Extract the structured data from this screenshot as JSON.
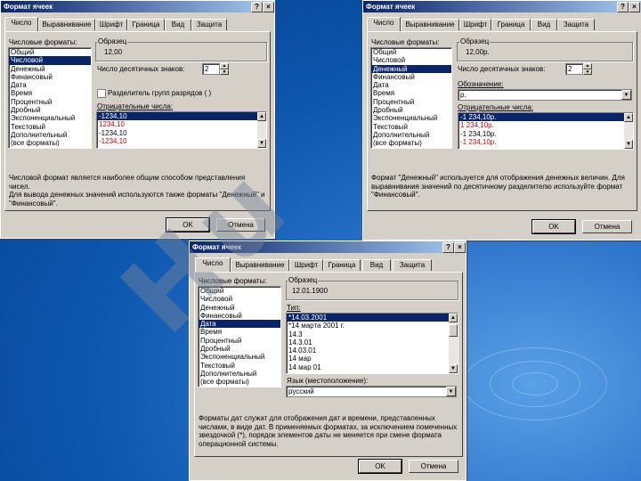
{
  "watermark": "Hu",
  "colors": {
    "title_start": "#0a246a",
    "title_end": "#a6caf0",
    "selection": "#0a246a",
    "negative_red": "#d00000",
    "dialog_face": "#d4d0c8"
  },
  "dialogs": [
    {
      "title": "Формат ячеек",
      "tabs": [
        "Число",
        "Выравнивание",
        "Шрифт",
        "Граница",
        "Вид",
        "Защита"
      ],
      "formats_label": "Числовые форматы:",
      "formats": [
        "Общий",
        "Числовой",
        "Денежный",
        "Финансовый",
        "Дата",
        "Время",
        "Процентный",
        "Дробный",
        "Экспоненциальный",
        "Текстовый",
        "Дополнительный",
        "(все форматы)"
      ],
      "selected_format": "Числовой",
      "sample_label": "Образец",
      "sample_value": "12,00",
      "decimals_label": "Число десятичных знаков:",
      "decimals_value": "2",
      "separator_label": "Разделитель групп разрядов ( )",
      "negative_label": "Отрицательные числа:",
      "negative_numbers": [
        "-1234,10",
        "1234,10",
        "-1234,10",
        "-1234,10"
      ],
      "description": "Числовой формат является наиболее общим способом представления чисел.\nДля вывода денежных значений используются также форматы \"Денежный\" и\n\"Финансовый\".",
      "ok": "OK",
      "cancel": "Отмена"
    },
    {
      "title": "Формат ячеек",
      "tabs": [
        "Число",
        "Выравнивание",
        "Шрифт",
        "Граница",
        "Вид",
        "Защита"
      ],
      "formats_label": "Числовые форматы:",
      "formats": [
        "Общий",
        "Числовой",
        "Денежный",
        "Финансовый",
        "Дата",
        "Время",
        "Процентный",
        "Дробный",
        "Экспоненциальный",
        "Текстовый",
        "Дополнительный",
        "(все форматы)"
      ],
      "selected_format": "Денежный",
      "sample_label": "Образец",
      "sample_value": "12,00р.",
      "decimals_label": "Число десятичных знаков:",
      "decimals_value": "2",
      "symbol_label": "Обозначение:",
      "symbol_value": "р.",
      "negative_label": "Отрицательные числа:",
      "negative_numbers": [
        "-1 234,10р.",
        "1 234,10р.",
        "-1 234,10р.",
        "-1 234,10р."
      ],
      "description": "Формат \"Денежный\" используется для отображения денежных величин. Для\nвыравнивания значений по десятичному разделителю используйте формат\n\"Финансовый\".",
      "ok": "OK",
      "cancel": "Отмена"
    },
    {
      "title": "Формат ячеек",
      "tabs": [
        "Число",
        "Выравнивание",
        "Шрифт",
        "Граница",
        "Вид",
        "Защита"
      ],
      "formats_label": "Числовые форматы:",
      "formats": [
        "Общий",
        "Числовой",
        "Денежный",
        "Финансовый",
        "Дата",
        "Время",
        "Процентный",
        "Дробный",
        "Экспоненциальный",
        "Текстовый",
        "Дополнительный",
        "(все форматы)"
      ],
      "selected_format": "Дата",
      "sample_label": "Образец",
      "sample_value": "12.01.1900",
      "type_label": "Тип:",
      "types": [
        "*14.03.2001",
        "*14 марта 2001 г.",
        "14.3",
        "14.3.01",
        "14.03.01",
        "14 мар",
        "14 мар 01"
      ],
      "locale_label": "Язык (местоположение):",
      "locale_value": "русский",
      "description": "Форматы дат служат для отображения дат и времени, представленных\nчислами, в виде дат. В применяемых форматах, за исключением помеченных\nзвездочкой (*), порядок элементов даты не меняется при смене формата\nоперационной системы.",
      "ok": "OK",
      "cancel": "Отмена"
    }
  ]
}
